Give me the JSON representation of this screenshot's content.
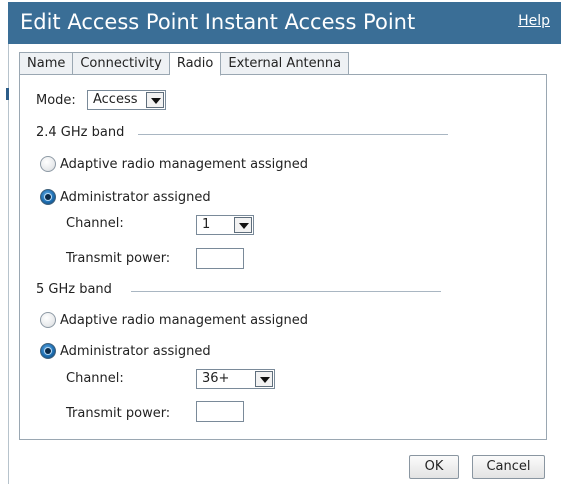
{
  "window": {
    "title": "Edit Access Point Instant Access Point",
    "help_label": "Help"
  },
  "tabs": [
    {
      "label": "Name",
      "active": false
    },
    {
      "label": "Connectivity",
      "active": false
    },
    {
      "label": "Radio",
      "active": true
    },
    {
      "label": "External Antenna",
      "active": false
    }
  ],
  "mode": {
    "label": "Mode:",
    "value": "Access"
  },
  "band24": {
    "title": "2.4 GHz band",
    "adaptive_label": "Adaptive radio management assigned",
    "admin_label": "Administrator assigned",
    "selected": "admin",
    "channel_label": "Channel:",
    "channel_value": "1",
    "power_label": "Transmit power:",
    "power_value": ""
  },
  "band5": {
    "title": "5 GHz band",
    "adaptive_label": "Adaptive radio management assigned",
    "admin_label": "Administrator assigned",
    "selected": "admin",
    "channel_label": "Channel:",
    "channel_value": "36+",
    "power_label": "Transmit power:",
    "power_value": ""
  },
  "buttons": {
    "ok_label": "OK",
    "cancel_label": "Cancel"
  },
  "colors": {
    "titlebar": "#3a6e96",
    "radio_selected": "#1f6fb2"
  }
}
